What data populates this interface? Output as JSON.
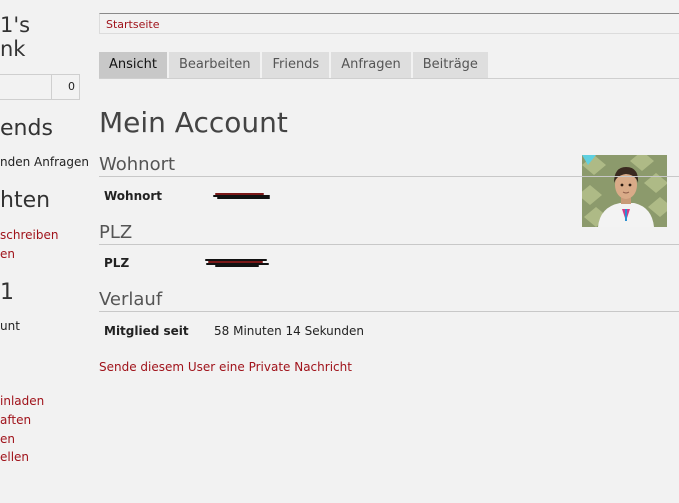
{
  "sidebar": {
    "title_line1": "1's",
    "title_line2": "nk",
    "count": "0",
    "friends_heading": "ends",
    "pending_requests": "nden Anfragen",
    "news_heading": "hten",
    "write_link": "schreiben",
    "en_link1": "en",
    "one_heading": "1",
    "account_text": "unt",
    "invite_link": "inladen",
    "props_link": "aften",
    "en_link2": "en",
    "settings_link": "ellen"
  },
  "breadcrumb": {
    "home": "Startseite"
  },
  "tabs": [
    {
      "label": "Ansicht",
      "active": true
    },
    {
      "label": "Bearbeiten",
      "active": false
    },
    {
      "label": "Friends",
      "active": false
    },
    {
      "label": "Anfragen",
      "active": false
    },
    {
      "label": "Beiträge",
      "active": false
    }
  ],
  "page": {
    "title": "Mein Account",
    "sections": {
      "wohnort": {
        "heading": "Wohnort",
        "label": "Wohnort"
      },
      "plz": {
        "heading": "PLZ",
        "label": "PLZ"
      },
      "verlauf": {
        "heading": "Verlauf",
        "label": "Mitglied seit",
        "value": "58 Minuten 14 Sekunden"
      }
    },
    "pm_link": "Sende diesem User eine Private Nachricht"
  },
  "colors": {
    "link": "#a0131b",
    "background": "#f2f2f2",
    "tab_active": "#c8c8c8",
    "tab": "#dedede"
  }
}
